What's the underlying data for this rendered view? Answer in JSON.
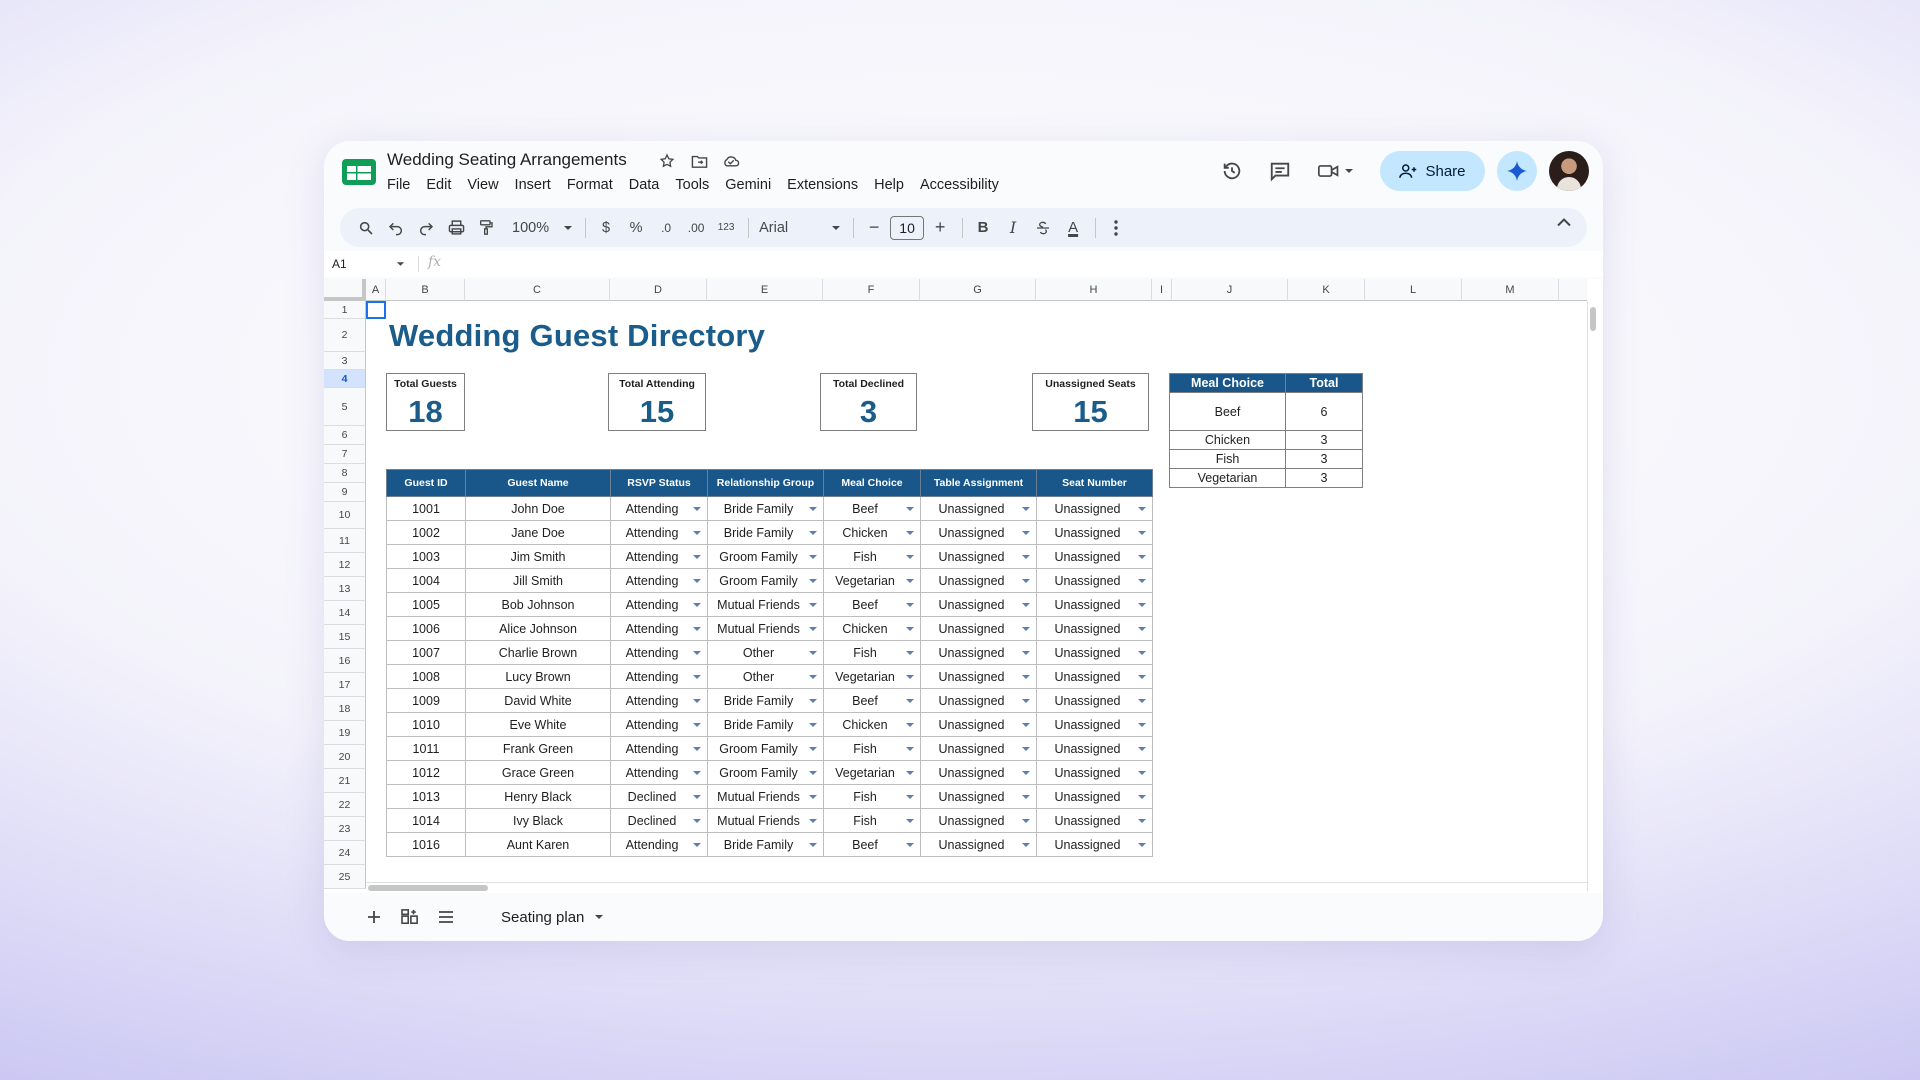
{
  "app": {
    "doc_title": "Wedding Seating Arrangements",
    "menu": [
      "File",
      "Edit",
      "View",
      "Insert",
      "Format",
      "Data",
      "Tools",
      "Gemini",
      "Extensions",
      "Help",
      "Accessibility"
    ],
    "share_label": "Share"
  },
  "toolbar": {
    "zoom": "100%",
    "currency": "$",
    "percent": "%",
    "dec_decrease": ".0",
    "dec_increase": ".00",
    "number_format": "123",
    "font": "Arial",
    "font_size": "10",
    "minus": "−",
    "plus": "+",
    "bold": "B",
    "italic": "I",
    "text_color": "A"
  },
  "formula_bar": {
    "cell_ref": "A1",
    "fx": "fx",
    "content": ""
  },
  "columns": [
    "A",
    "B",
    "C",
    "D",
    "E",
    "F",
    "G",
    "H",
    "I",
    "J",
    "K",
    "L",
    "M"
  ],
  "rows": [
    "1",
    "2",
    "3",
    "4",
    "5",
    "6",
    "7",
    "8",
    "9",
    "10",
    "11",
    "12",
    "13",
    "14",
    "15",
    "16",
    "17",
    "18",
    "19",
    "20",
    "21",
    "22",
    "23",
    "24",
    "25"
  ],
  "sheet": {
    "title": "Wedding Guest Directory",
    "cards": [
      {
        "label": "Total Guests",
        "value": "18"
      },
      {
        "label": "Total Attending",
        "value": "15"
      },
      {
        "label": "Total Declined",
        "value": "3"
      },
      {
        "label": "Unassigned Seats",
        "value": "15"
      }
    ],
    "meal_summary": {
      "headers": [
        "Meal Choice",
        "Total"
      ],
      "rows": [
        [
          "Beef",
          "6"
        ],
        [
          "Chicken",
          "3"
        ],
        [
          "Fish",
          "3"
        ],
        [
          "Vegetarian",
          "3"
        ]
      ]
    },
    "guest_table": {
      "headers": [
        "Guest ID",
        "Guest Name",
        "RSVP Status",
        "Relationship Group",
        "Meal Choice",
        "Table Assignment",
        "Seat Number"
      ],
      "rows": [
        [
          "1001",
          "John Doe",
          "Attending",
          "Bride Family",
          "Beef",
          "Unassigned",
          "Unassigned"
        ],
        [
          "1002",
          "Jane Doe",
          "Attending",
          "Bride Family",
          "Chicken",
          "Unassigned",
          "Unassigned"
        ],
        [
          "1003",
          "Jim Smith",
          "Attending",
          "Groom Family",
          "Fish",
          "Unassigned",
          "Unassigned"
        ],
        [
          "1004",
          "Jill Smith",
          "Attending",
          "Groom Family",
          "Vegetarian",
          "Unassigned",
          "Unassigned"
        ],
        [
          "1005",
          "Bob Johnson",
          "Attending",
          "Mutual Friends",
          "Beef",
          "Unassigned",
          "Unassigned"
        ],
        [
          "1006",
          "Alice Johnson",
          "Attending",
          "Mutual Friends",
          "Chicken",
          "Unassigned",
          "Unassigned"
        ],
        [
          "1007",
          "Charlie Brown",
          "Attending",
          "Other",
          "Fish",
          "Unassigned",
          "Unassigned"
        ],
        [
          "1008",
          "Lucy Brown",
          "Attending",
          "Other",
          "Vegetarian",
          "Unassigned",
          "Unassigned"
        ],
        [
          "1009",
          "David White",
          "Attending",
          "Bride Family",
          "Beef",
          "Unassigned",
          "Unassigned"
        ],
        [
          "1010",
          "Eve White",
          "Attending",
          "Bride Family",
          "Chicken",
          "Unassigned",
          "Unassigned"
        ],
        [
          "1011",
          "Frank Green",
          "Attending",
          "Groom Family",
          "Fish",
          "Unassigned",
          "Unassigned"
        ],
        [
          "1012",
          "Grace Green",
          "Attending",
          "Groom Family",
          "Vegetarian",
          "Unassigned",
          "Unassigned"
        ],
        [
          "1013",
          "Henry Black",
          "Declined",
          "Mutual Friends",
          "Fish",
          "Unassigned",
          "Unassigned"
        ],
        [
          "1014",
          "Ivy Black",
          "Declined",
          "Mutual Friends",
          "Fish",
          "Unassigned",
          "Unassigned"
        ],
        [
          "1016",
          "Aunt Karen",
          "Attending",
          "Bride Family",
          "Beef",
          "Unassigned",
          "Unassigned"
        ]
      ]
    }
  },
  "bottom": {
    "sheet_tab": "Seating plan"
  },
  "colors": {
    "header_blue": "#19578a",
    "title_blue": "#1a5c8a",
    "share_bg": "#c2e7ff"
  }
}
